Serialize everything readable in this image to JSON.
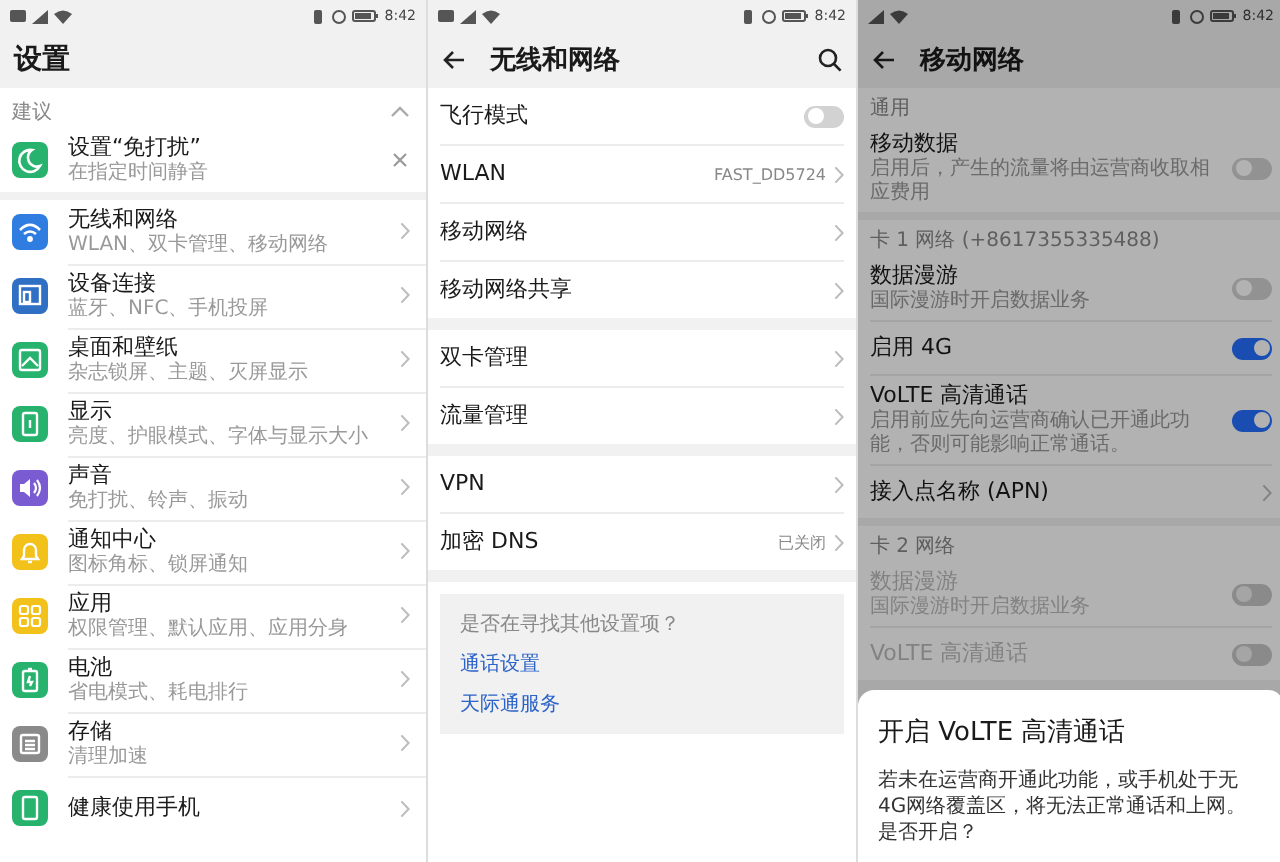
{
  "settings": {
    "time": "8:42",
    "title": "设置",
    "section_label": "建议",
    "suggestion": {
      "title": "设置“免打扰”",
      "subtitle": "在指定时间静音"
    },
    "items": [
      {
        "kind": "wifi",
        "title": "无线和网络",
        "subtitle": "WLAN、双卡管理、移动网络",
        "color": "#2f7de1"
      },
      {
        "kind": "devices",
        "title": "设备连接",
        "subtitle": "蓝牙、NFC、手机投屏",
        "color": "#2f6fc4"
      },
      {
        "kind": "wallpaper",
        "title": "桌面和壁纸",
        "subtitle": "杂志锁屏、主题、灭屏显示",
        "color": "#27b36d"
      },
      {
        "kind": "display",
        "title": "显示",
        "subtitle": "亮度、护眼模式、字体与显示大小",
        "color": "#27b36d"
      },
      {
        "kind": "sound",
        "title": "声音",
        "subtitle": "免打扰、铃声、振动",
        "color": "#7a5bd1"
      },
      {
        "kind": "bell",
        "title": "通知中心",
        "subtitle": "图标角标、锁屏通知",
        "color": "#f2c21b"
      },
      {
        "kind": "apps",
        "title": "应用",
        "subtitle": "权限管理、默认应用、应用分身",
        "color": "#f2c21b"
      },
      {
        "kind": "battery",
        "title": "电池",
        "subtitle": "省电模式、耗电排行",
        "color": "#27b36d"
      },
      {
        "kind": "storage",
        "title": "存储",
        "subtitle": "清理加速",
        "color": "#8a8a8a"
      },
      {
        "kind": "health",
        "title": "健康使用手机",
        "color": "#27b36d"
      }
    ]
  },
  "wireless_network": {
    "time": "8:42",
    "title": "无线和网络",
    "groups": [
      [
        {
          "kind": "toggle",
          "label": "飞行模式",
          "on": false
        },
        {
          "kind": "link",
          "label": "WLAN",
          "value": "FAST_DD5724"
        },
        {
          "kind": "link",
          "label": "移动网络"
        },
        {
          "kind": "link",
          "label": "移动网络共享"
        }
      ],
      [
        {
          "kind": "link",
          "label": "双卡管理"
        },
        {
          "kind": "link",
          "label": "流量管理"
        }
      ],
      [
        {
          "kind": "link",
          "label": "VPN"
        },
        {
          "kind": "link",
          "label": "加密 DNS",
          "value": "已关闭"
        }
      ]
    ],
    "help": {
      "question": "是否在寻找其他设置项？",
      "links": [
        "通话设置",
        "天际通服务"
      ]
    }
  },
  "mobile_network": {
    "time": "8:42",
    "title": "移动网络",
    "groups": [
      {
        "header": "通用",
        "rows": [
          {
            "kind": "toggle",
            "label": "移动数据",
            "subtitle": "启用后，产生的流量将由运营商收取相应费用",
            "on": false,
            "disabled": false
          }
        ]
      },
      {
        "header": "卡 1 网络 (+8617355335488)",
        "rows": [
          {
            "kind": "toggle",
            "label": "数据漫游",
            "subtitle": "国际漫游时开启数据业务",
            "on": false,
            "disabled": false
          },
          {
            "kind": "toggle",
            "label": "启用 4G",
            "on": true,
            "disabled": false
          },
          {
            "kind": "toggle",
            "label": "VoLTE 高清通话",
            "subtitle": "启用前应先向运营商确认已开通此功能，否则可能影响正常通话。",
            "on": true,
            "disabled": false
          },
          {
            "kind": "link",
            "label": "接入点名称 (APN)",
            "disabled": false
          }
        ]
      },
      {
        "header": "卡 2 网络",
        "rows": [
          {
            "kind": "toggle",
            "label": "数据漫游",
            "subtitle": "国际漫游时开启数据业务",
            "on": false,
            "disabled": true
          },
          {
            "kind": "toggle",
            "label": "VoLTE 高清通话",
            "on": false,
            "disabled": true
          }
        ]
      }
    ],
    "dialog": {
      "title": "开启 VoLTE 高清通话",
      "body": "若未在运营商开通此功能，或手机处于无4G网络覆盖区，将无法正常通话和上网。是否开启？"
    }
  }
}
